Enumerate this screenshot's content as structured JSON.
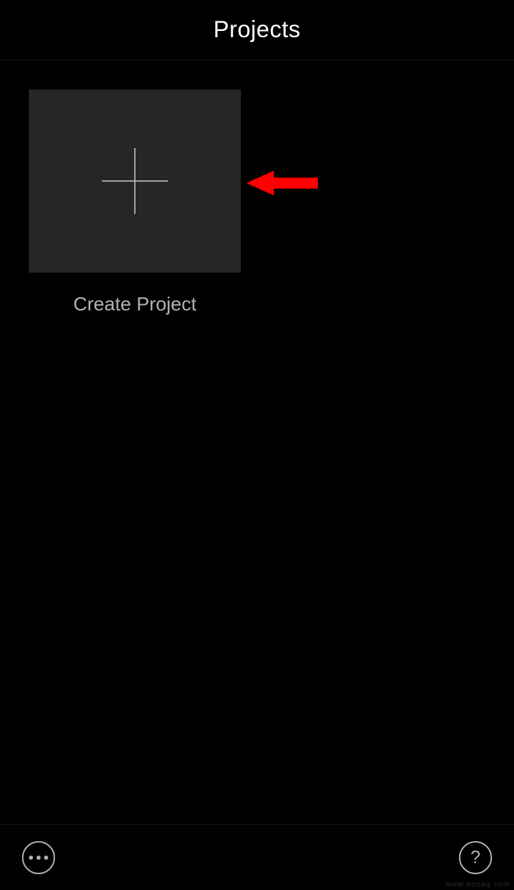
{
  "header": {
    "title": "Projects"
  },
  "content": {
    "createProjectLabel": "Create Project"
  },
  "footer": {
    "moreIconName": "more",
    "helpIconName": "help"
  },
  "watermark": "www.deuaq.com",
  "annotation": {
    "arrowColor": "#ff0000"
  }
}
